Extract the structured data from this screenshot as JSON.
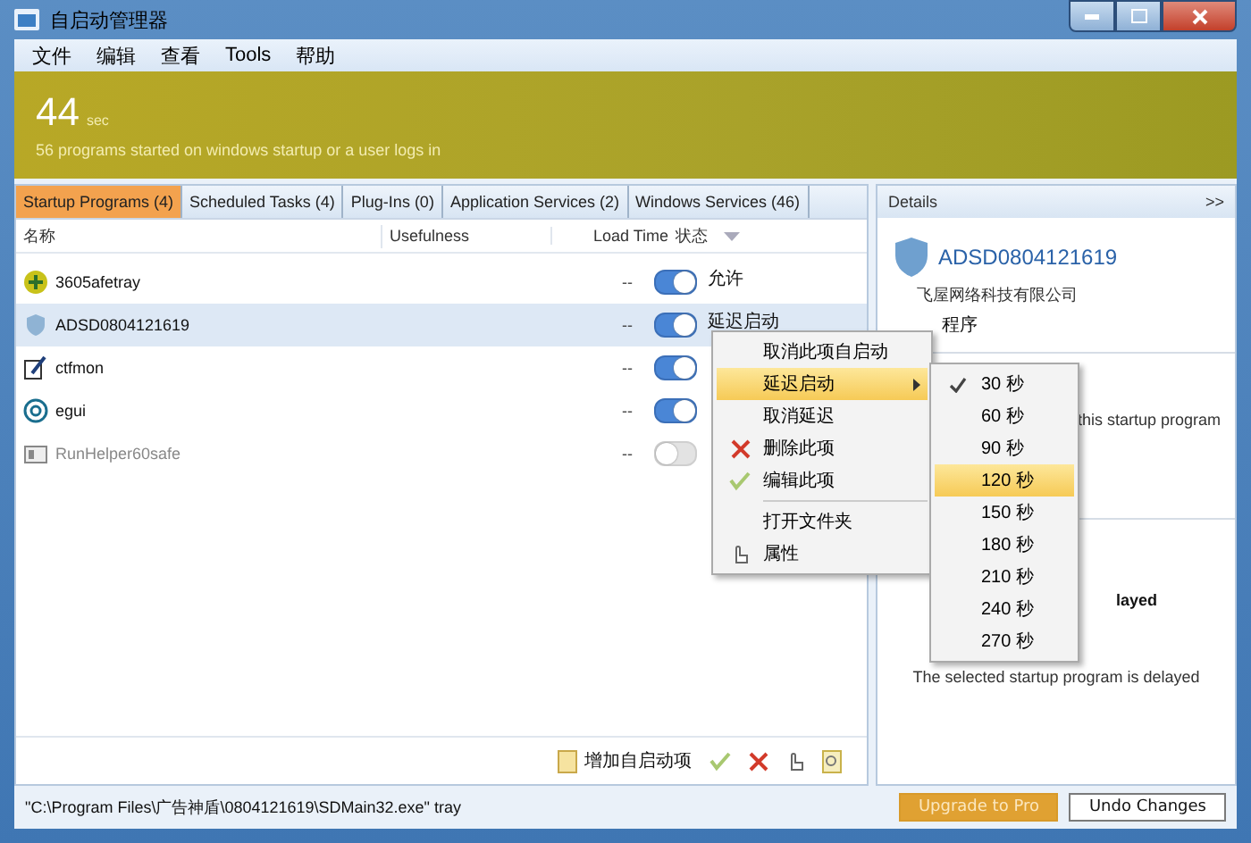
{
  "window": {
    "title": "自启动管理器"
  },
  "menu_bar": [
    "文件",
    "编辑",
    "查看",
    "Tools",
    "帮助"
  ],
  "banner": {
    "value": "44",
    "unit": "sec",
    "description": "56 programs started on windows startup or a user logs in"
  },
  "tabs": [
    {
      "label": "Startup Programs (4)",
      "selected": true
    },
    {
      "label": "Scheduled Tasks (4)",
      "selected": false
    },
    {
      "label": "Plug-Ins (0)",
      "selected": false
    },
    {
      "label": "Application Services (2)",
      "selected": false
    },
    {
      "label": "Windows Services (46)",
      "selected": false
    }
  ],
  "table": {
    "columns": [
      "名称",
      "Usefulness",
      "Load Time",
      "状态"
    ],
    "rows": [
      {
        "name": "3605afetray",
        "load_time": "--",
        "enabled": true,
        "status": "允许",
        "selected": false
      },
      {
        "name": "ADSD0804121619",
        "load_time": "--",
        "enabled": true,
        "status": "延迟启动",
        "selected": true
      },
      {
        "name": "ctfmon",
        "load_time": "--",
        "enabled": true,
        "selected": false
      },
      {
        "name": "egui",
        "load_time": "--",
        "enabled": true,
        "selected": false
      },
      {
        "name": "RunHelper60safe",
        "load_time": "--",
        "enabled": false,
        "selected": false
      }
    ]
  },
  "toolbar": {
    "add_label": "增加自启动项"
  },
  "details": {
    "title": "Details",
    "collapse": ">>",
    "name": "ADSD0804121619",
    "company": "飞屋网络科技有限公司",
    "type": "程序",
    "text_1": "this startup program",
    "heading": "layed",
    "text_2": "The selected startup program is delayed"
  },
  "context_menu": [
    {
      "kind": "item",
      "label": "取消此项自启动",
      "selected": false
    },
    {
      "kind": "submenu",
      "label": "延迟启动",
      "selected": true
    },
    {
      "kind": "item",
      "label": "取消延迟",
      "selected": false
    },
    {
      "kind": "delete",
      "label": "删除此项",
      "selected": false
    },
    {
      "kind": "edit",
      "label": "编辑此项",
      "selected": false
    },
    {
      "kind": "separator"
    },
    {
      "kind": "item",
      "label": "打开文件夹",
      "selected": false
    },
    {
      "kind": "properties",
      "label": "属性",
      "selected": false
    }
  ],
  "submenu": [
    {
      "label": "30 秒",
      "checked": true,
      "selected": false
    },
    {
      "label": "60 秒",
      "checked": false,
      "selected": false
    },
    {
      "label": "90 秒",
      "checked": false,
      "selected": false
    },
    {
      "label": "120 秒",
      "checked": false,
      "selected": true
    },
    {
      "label": "150 秒",
      "checked": false,
      "selected": false
    },
    {
      "label": "180 秒",
      "checked": false,
      "selected": false
    },
    {
      "label": "210 秒",
      "checked": false,
      "selected": false
    },
    {
      "label": "240 秒",
      "checked": false,
      "selected": false
    },
    {
      "label": "270 秒",
      "checked": false,
      "selected": false
    }
  ],
  "status_bar": {
    "path": "\"C:\\Program Files\\广告神盾\\0804121619\\SDMain32.exe\" tray",
    "upgrade": "Upgrade to Pro",
    "undo": "Undo Changes"
  }
}
